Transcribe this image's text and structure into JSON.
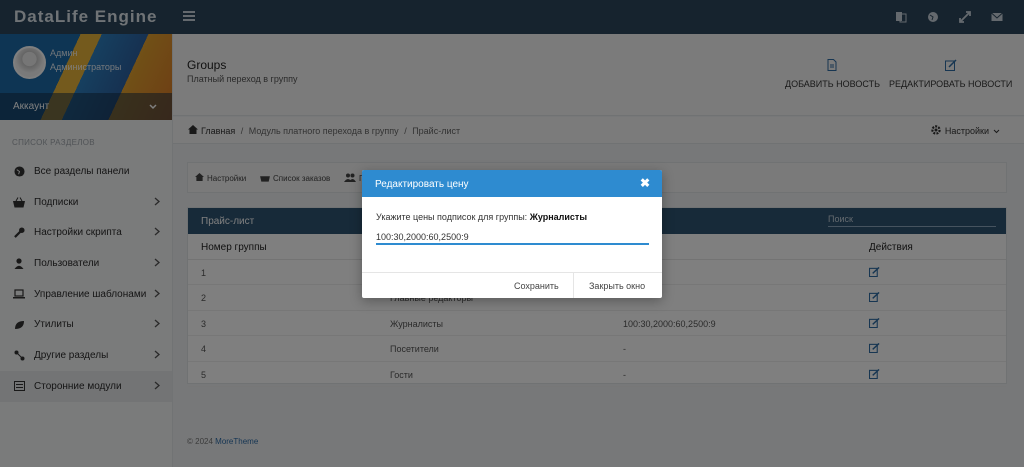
{
  "app": {
    "brand": "DataLife Engine"
  },
  "profile": {
    "name": "Админ",
    "role": "Администраторы",
    "account_label": "Аккаунт"
  },
  "sidebar": {
    "section_title": "СПИСОК РАЗДЕЛОВ",
    "items": [
      {
        "label": "Все разделы панели",
        "icon": "globe-icon",
        "arrow": false
      },
      {
        "label": "Подписки",
        "icon": "basket-icon",
        "arrow": true
      },
      {
        "label": "Настройки скрипта",
        "icon": "wrench-icon",
        "arrow": true
      },
      {
        "label": "Пользователи",
        "icon": "user-icon",
        "arrow": true
      },
      {
        "label": "Управление шаблонами",
        "icon": "laptop-icon",
        "arrow": true
      },
      {
        "label": "Утилиты",
        "icon": "leaf-icon",
        "arrow": true
      },
      {
        "label": "Другие разделы",
        "icon": "share-icon",
        "arrow": true
      },
      {
        "label": "Сторонние модули",
        "icon": "list-icon",
        "arrow": true
      }
    ]
  },
  "header": {
    "title": "Groups",
    "subtitle": "Платный переход в группу",
    "add_news": "ДОБАВИТЬ НОВОСТЬ",
    "edit_news": "РЕДАКТИРОВАТЬ НОВОСТИ"
  },
  "breadcrumb": {
    "home": "Главная",
    "module": "Модуль платного перехода в группу",
    "current": "Прайс-лист",
    "settings": "Настройки"
  },
  "toolbar": {
    "settings": "Настройки",
    "orders": "Список заказов",
    "groups": "Г..."
  },
  "table": {
    "title": "Прайс-лист",
    "search_placeholder": "Поиск",
    "columns": {
      "number": "Номер группы",
      "actions": "Действия"
    },
    "rows": [
      {
        "num": "1",
        "group": "",
        "prices": ""
      },
      {
        "num": "2",
        "group": "Главные редакторы",
        "prices": ""
      },
      {
        "num": "3",
        "group": "Журналисты",
        "prices": "100:30,2000:60,2500:9"
      },
      {
        "num": "4",
        "group": "Посетители",
        "prices": "-"
      },
      {
        "num": "5",
        "group": "Гости",
        "prices": "-"
      }
    ]
  },
  "footer": {
    "copyright": "© 2024",
    "brand": "MoreTheme"
  },
  "modal": {
    "title": "Редактировать цену",
    "label": "Укажите цены подписок для группы:",
    "group": "Журналисты",
    "value": "100:30,2000:60,2500:9",
    "save": "Сохранить",
    "close": "Закрыть окно"
  },
  "colors": {
    "topbar": "#2d475c",
    "accent": "#2e8bd0",
    "panel_head": "#2f5472"
  }
}
